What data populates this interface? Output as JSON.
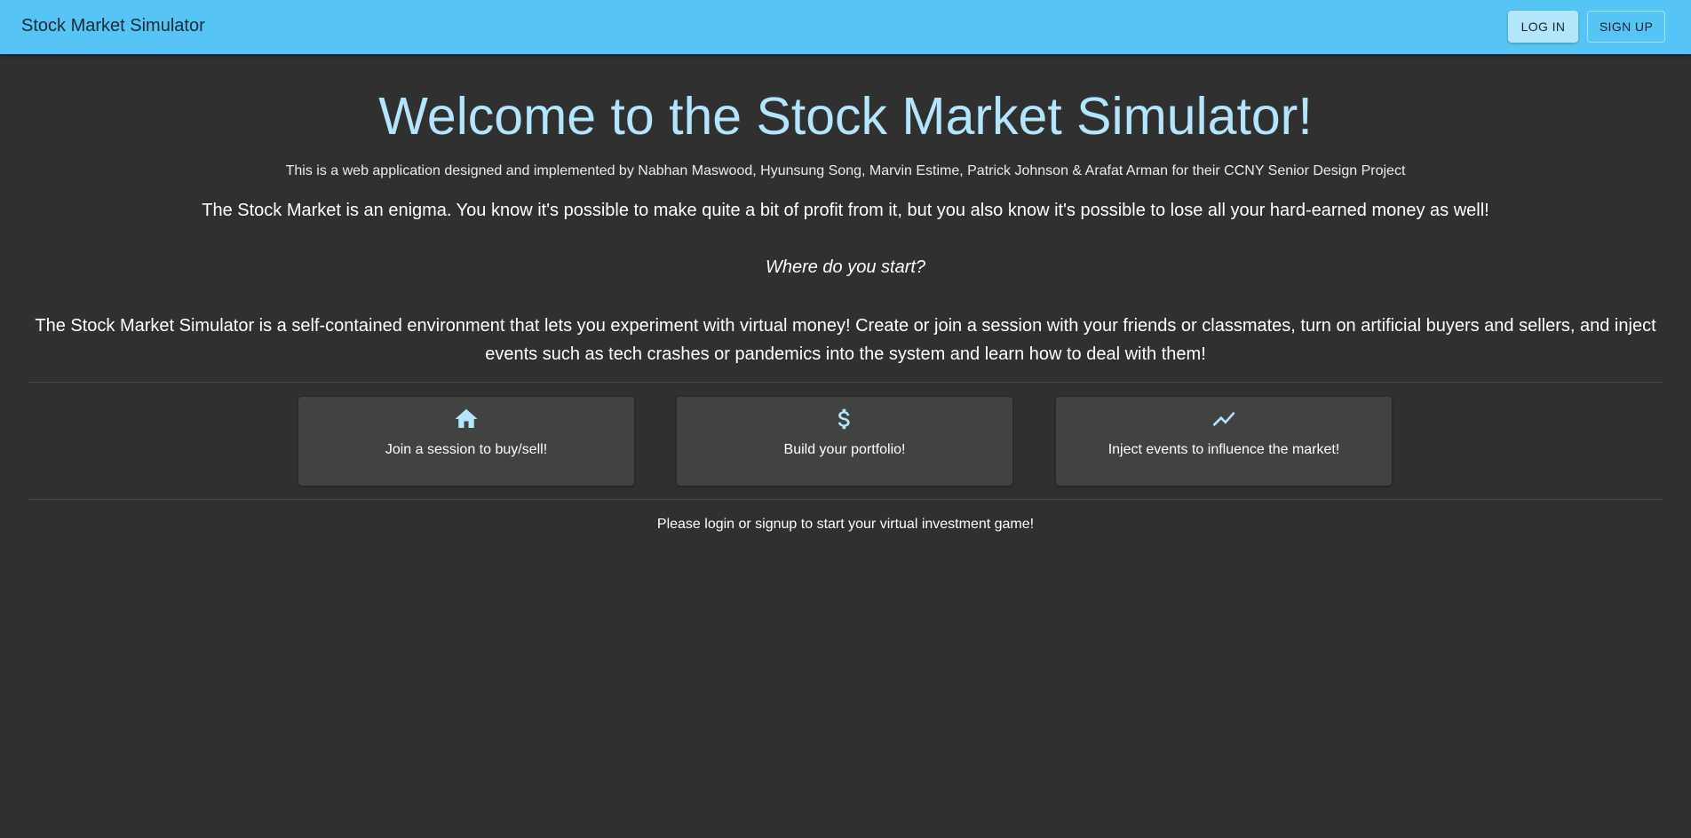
{
  "appbar": {
    "title": "Stock Market Simulator",
    "login_label": "LOG IN",
    "signup_label": "SIGN UP",
    "color": "#56c5f5"
  },
  "main": {
    "headline": "Welcome to the Stock Market Simulator!",
    "credits": "This is a web application designed and implemented by Nabhan Maswood, Hyunsung Song, Marvin Estime, Patrick Johnson & Arafat Arman for their CCNY Senior Design Project",
    "lead": "The Stock Market is an enigma. You know it's possible to make quite a bit of profit from it, but you also know it's possible to lose all your hard-earned money as well!",
    "question": "Where do you start?",
    "description": "The Stock Market Simulator is a self-contained environment that lets you experiment with virtual money! Create or join a session with your friends or classmates, turn on artificial buyers and sellers, and inject events such as tech crashes or pandemics into the system and learn how to deal with them!",
    "headline_color": "#b3e5fc",
    "background": "#303030"
  },
  "features": [
    {
      "icon": "home-icon",
      "label": "Join a session to buy/sell!"
    },
    {
      "icon": "dollar-icon",
      "label": "Build your portfolio!"
    },
    {
      "icon": "trending-line-icon",
      "label": "Inject events to influence the market!"
    }
  ],
  "prompt": "Please login or signup to start your virtual investment game!"
}
